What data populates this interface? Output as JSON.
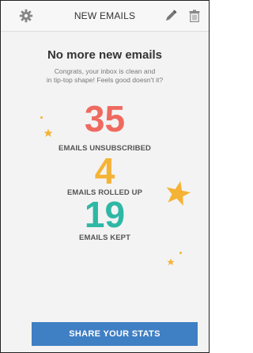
{
  "header": {
    "title": "NEW EMAILS",
    "left_icon": "gear-icon",
    "right_icons": [
      "pencil-icon",
      "trash-icon"
    ]
  },
  "message": {
    "headline": "No more new emails",
    "subtext_line1": "Congrats, your inbox is clean and",
    "subtext_line2": "in tip-top shape! Feels good doesn't it?"
  },
  "stats": [
    {
      "value": "35",
      "label": "EMAILS UNSUBSCRIBED",
      "color": "#ee6a5f"
    },
    {
      "value": "4",
      "label": "EMAILS ROLLED UP",
      "color": "#f5b335"
    },
    {
      "value": "19",
      "label": "EMAILS KEPT",
      "color": "#2fb7a5"
    }
  ],
  "decorations": {
    "star_color": "#f5b335"
  },
  "share_button": {
    "label": "SHARE YOUR STATS",
    "color": "#3f7fc4"
  }
}
